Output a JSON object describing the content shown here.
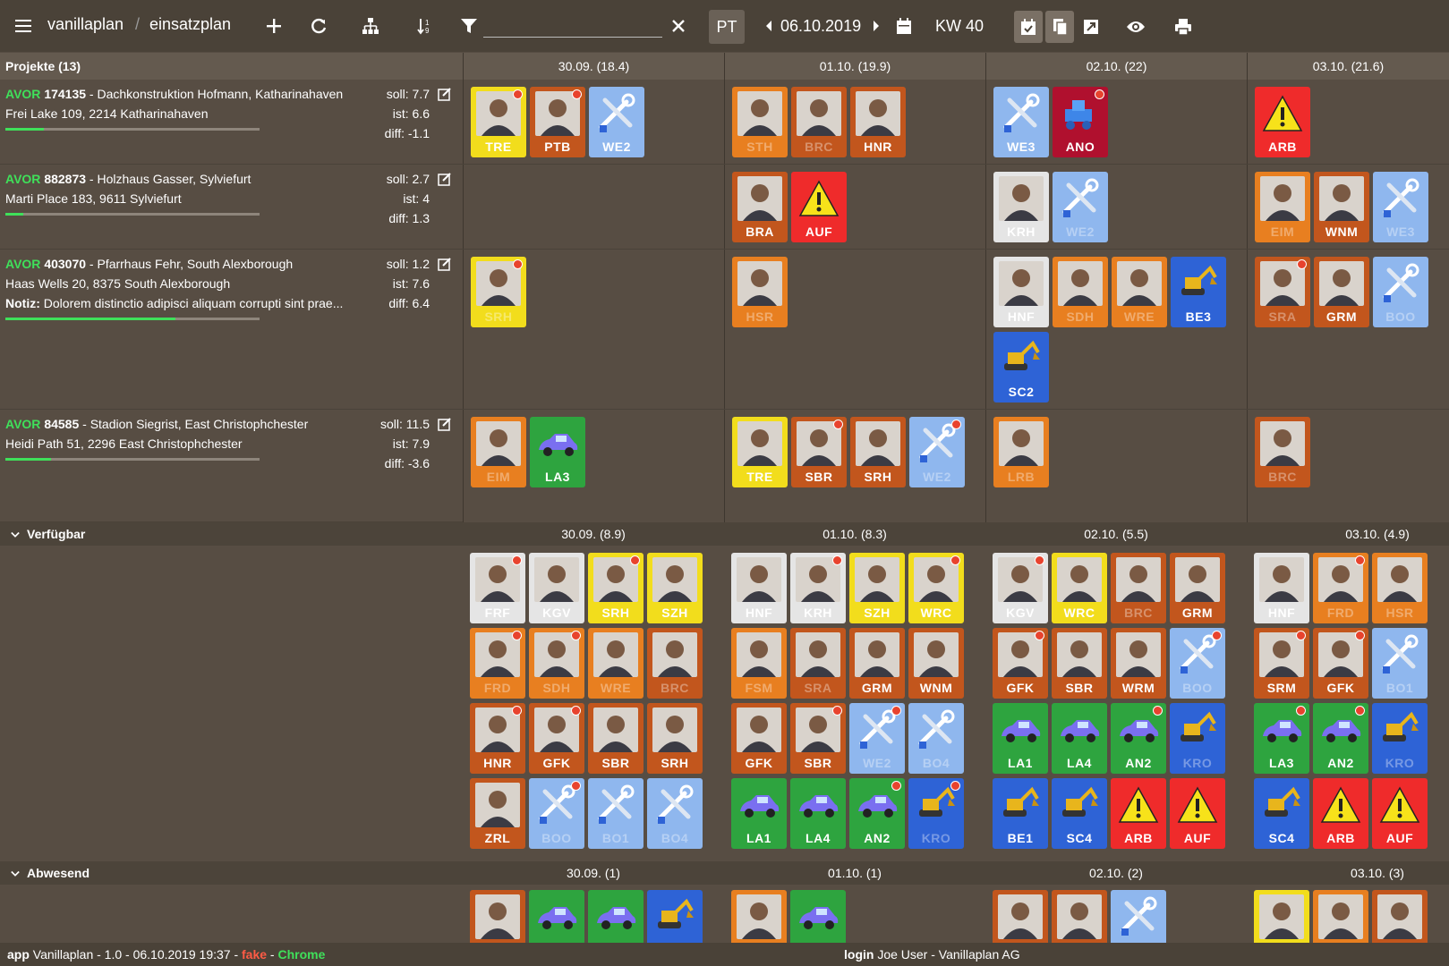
{
  "colors": {
    "yellow": "#f2dd1c",
    "orange": "#e87f20",
    "darkorange": "#c2561d",
    "red": "#ef2b2b",
    "lightblue": "#8fb7ee",
    "blue": "#2e63d6",
    "green": "#2ea43f",
    "white": "#e5e5e5",
    "crimson": "#b0102e"
  },
  "toolbar": {
    "menu_icon": "hamburger-icon",
    "breadcrumb": [
      "vanillaplan",
      "einsatzplan"
    ],
    "separator": "/",
    "filter_value": "",
    "pt_label": "PT",
    "date": "06.10.2019",
    "kw": "KW 40"
  },
  "projects_header": "Projekte (13)",
  "projects": [
    {
      "avor": "AVOR",
      "num": "174135",
      "title": " - Dachkonstruktion Hofmann, Katharinahaven",
      "addr": "Frei Lake 109, 2214 Katharinahaven",
      "note_label": "",
      "note": "",
      "soll": "soll: 7.7",
      "ist": "ist: 6.6",
      "diff": "diff: -1.1",
      "progress": 0.15
    },
    {
      "avor": "AVOR",
      "num": "882873",
      "title": " - Holzhaus Gasser, Sylviefurt",
      "addr": "Marti Place 183, 9611 Sylviefurt",
      "note_label": "",
      "note": "",
      "soll": "soll: 2.7",
      "ist": "ist: 4",
      "diff": "diff: 1.3",
      "progress": 0.07
    },
    {
      "avor": "AVOR",
      "num": "403070",
      "title": " - Pfarrhaus Fehr, South Alexborough",
      "addr": "Haas Wells 20, 8375 South Alexborough",
      "note_label": "Notiz:",
      "note": " Dolorem distinctio adipisci aliquam corrupti sint prae...",
      "soll": "soll: 1.2",
      "ist": "ist: 7.6",
      "diff": "diff: 6.4",
      "progress": 0.67
    },
    {
      "avor": "AVOR",
      "num": "84585",
      "title": " - Stadion Siegrist, East Christophchester",
      "addr": "Heidi Path 51, 2296 East Christophchester",
      "note_label": "",
      "note": "",
      "soll": "soll: 11.5",
      "ist": "ist: 7.9",
      "diff": "diff: -3.6",
      "progress": 0.18
    }
  ],
  "day_headers": [
    "30.09. (18.4)",
    "01.10. (19.9)",
    "02.10. (22)",
    "03.10. (21.6)"
  ],
  "project_tiles": [
    [
      [
        [
          "TRE",
          "yellow",
          "person",
          1,
          0
        ],
        [
          "PTB",
          "darkorange",
          "person",
          1,
          0
        ],
        [
          "WE2",
          "lightblue",
          "tools",
          0,
          0
        ]
      ],
      [
        [
          "STH",
          "orange",
          "person",
          0,
          1
        ],
        [
          "BRC",
          "darkorange",
          "person",
          0,
          1
        ],
        [
          "HNR",
          "darkorange",
          "person",
          0,
          0
        ]
      ],
      [
        [
          "WE3",
          "lightblue",
          "tools",
          0,
          0
        ],
        [
          "ANO",
          "crimson",
          "machine",
          1,
          0
        ]
      ],
      [
        [
          "ARB",
          "red",
          "warning",
          0,
          0
        ]
      ]
    ],
    [
      [],
      [
        [
          "BRA",
          "darkorange",
          "person",
          0,
          0
        ],
        [
          "AUF",
          "red",
          "warning",
          0,
          0
        ]
      ],
      [
        [
          "KRH",
          "white",
          "person",
          0,
          0
        ],
        [
          "WE2",
          "lightblue",
          "tools",
          0,
          1
        ]
      ],
      [
        [
          "EIM",
          "orange",
          "person",
          0,
          1
        ],
        [
          "WNM",
          "darkorange",
          "person",
          0,
          0
        ],
        [
          "WE3",
          "lightblue",
          "tools",
          0,
          1
        ]
      ]
    ],
    [
      [
        [
          "SRH",
          "yellow",
          "person",
          1,
          1
        ]
      ],
      [
        [
          "HSR",
          "orange",
          "person",
          0,
          1
        ]
      ],
      [
        [
          "HNF",
          "white",
          "person",
          0,
          0
        ],
        [
          "SDH",
          "orange",
          "person",
          0,
          1
        ],
        [
          "WRE",
          "orange",
          "person",
          0,
          1
        ],
        [
          "BE3",
          "blue",
          "excavator",
          0,
          0
        ],
        [
          "SC2",
          "blue",
          "excavator",
          0,
          0
        ]
      ],
      [
        [
          "SRA",
          "darkorange",
          "person",
          1,
          1
        ],
        [
          "GRM",
          "darkorange",
          "person",
          0,
          0
        ],
        [
          "BOO",
          "lightblue",
          "tools",
          0,
          1
        ]
      ]
    ],
    [
      [
        [
          "EIM",
          "orange",
          "person",
          0,
          1
        ],
        [
          "LA3",
          "green",
          "car",
          0,
          0
        ]
      ],
      [
        [
          "TRE",
          "yellow",
          "person",
          0,
          0
        ],
        [
          "SBR",
          "darkorange",
          "person",
          1,
          0
        ],
        [
          "SRH",
          "darkorange",
          "person",
          0,
          0
        ],
        [
          "WE2",
          "lightblue",
          "tools",
          1,
          1
        ]
      ],
      [
        [
          "LRB",
          "orange",
          "person",
          0,
          1
        ]
      ],
      [
        [
          "BRC",
          "darkorange",
          "person",
          0,
          1
        ]
      ]
    ]
  ],
  "verfuegbar": {
    "title": "Verfügbar",
    "dates": [
      "30.09. (8.9)",
      "01.10. (8.3)",
      "02.10. (5.5)",
      "03.10. (4.9)"
    ],
    "tiles": [
      [
        [
          "FRF",
          "white",
          "person",
          1,
          0
        ],
        [
          "KGV",
          "white",
          "person",
          0,
          0
        ],
        [
          "SRH",
          "yellow",
          "person",
          1,
          0
        ],
        [
          "SZH",
          "yellow",
          "person",
          0,
          0
        ],
        [
          "FRD",
          "orange",
          "person",
          1,
          1
        ],
        [
          "SDH",
          "orange",
          "person",
          1,
          1
        ],
        [
          "WRE",
          "orange",
          "person",
          0,
          1
        ],
        [
          "BRC",
          "darkorange",
          "person",
          0,
          1
        ],
        [
          "HNR",
          "darkorange",
          "person",
          1,
          0
        ],
        [
          "GFK",
          "darkorange",
          "person",
          1,
          0
        ],
        [
          "SBR",
          "darkorange",
          "person",
          0,
          0
        ],
        [
          "SRH",
          "darkorange",
          "person",
          0,
          0
        ],
        [
          "ZRL",
          "darkorange",
          "person",
          0,
          0
        ],
        [
          "BOO",
          "lightblue",
          "tools",
          1,
          1
        ],
        [
          "BO1",
          "lightblue",
          "tools",
          0,
          1
        ],
        [
          "BO4",
          "lightblue",
          "tools",
          0,
          1
        ]
      ],
      [
        [
          "HNF",
          "white",
          "person",
          0,
          0
        ],
        [
          "KRH",
          "white",
          "person",
          1,
          0
        ],
        [
          "SZH",
          "yellow",
          "person",
          0,
          0
        ],
        [
          "WRC",
          "yellow",
          "person",
          1,
          0
        ],
        [
          "FSM",
          "orange",
          "person",
          0,
          1
        ],
        [
          "SRA",
          "darkorange",
          "person",
          0,
          1
        ],
        [
          "GRM",
          "darkorange",
          "person",
          0,
          0
        ],
        [
          "WNM",
          "darkorange",
          "person",
          0,
          0
        ],
        [
          "GFK",
          "darkorange",
          "person",
          0,
          0
        ],
        [
          "SBR",
          "darkorange",
          "person",
          1,
          0
        ],
        [
          "WE2",
          "lightblue",
          "tools",
          1,
          1
        ],
        [
          "BO4",
          "lightblue",
          "tools",
          0,
          1
        ],
        [
          "LA1",
          "green",
          "car",
          0,
          0
        ],
        [
          "LA4",
          "green",
          "car",
          0,
          0
        ],
        [
          "AN2",
          "green",
          "car",
          1,
          0
        ],
        [
          "KRO",
          "blue",
          "excavator",
          1,
          1
        ]
      ],
      [
        [
          "KGV",
          "white",
          "person",
          1,
          0
        ],
        [
          "WRC",
          "yellow",
          "person",
          0,
          0
        ],
        [
          "BRC",
          "darkorange",
          "person",
          0,
          1
        ],
        [
          "GRM",
          "darkorange",
          "person",
          0,
          0
        ],
        [
          "GFK",
          "darkorange",
          "person",
          1,
          0
        ],
        [
          "SBR",
          "darkorange",
          "person",
          0,
          0
        ],
        [
          "WRM",
          "darkorange",
          "person",
          0,
          0
        ],
        [
          "BOO",
          "lightblue",
          "tools",
          1,
          1
        ],
        [
          "LA1",
          "green",
          "car",
          0,
          0
        ],
        [
          "LA4",
          "green",
          "car",
          0,
          0
        ],
        [
          "AN2",
          "green",
          "car",
          1,
          0
        ],
        [
          "KRO",
          "blue",
          "excavator",
          0,
          1
        ],
        [
          "BE1",
          "blue",
          "excavator",
          0,
          0
        ],
        [
          "SC4",
          "blue",
          "excavator",
          0,
          0
        ],
        [
          "ARB",
          "red",
          "warning",
          0,
          0
        ],
        [
          "AUF",
          "red",
          "warning",
          0,
          0
        ]
      ],
      [
        [
          "HNF",
          "white",
          "person",
          0,
          0
        ],
        [
          "FRD",
          "orange",
          "person",
          1,
          1
        ],
        [
          "HSR",
          "orange",
          "person",
          0,
          1
        ],
        [
          "SRM",
          "darkorange",
          "person",
          1,
          0
        ],
        [
          "GFK",
          "darkorange",
          "person",
          1,
          0
        ],
        [
          "BO1",
          "lightblue",
          "tools",
          0,
          1
        ],
        [
          "LA3",
          "green",
          "car",
          1,
          0
        ],
        [
          "AN2",
          "green",
          "car",
          1,
          0
        ],
        [
          "KRO",
          "blue",
          "excavator",
          0,
          1
        ],
        [
          "SC4",
          "blue",
          "excavator",
          0,
          0
        ],
        [
          "ARB",
          "red",
          "warning",
          0,
          0
        ],
        [
          "AUF",
          "red",
          "warning",
          0,
          0
        ]
      ]
    ]
  },
  "abwesend": {
    "title": "Abwesend",
    "dates": [
      "30.09. (1)",
      "01.10. (1)",
      "02.10. (2)",
      "03.10. (3)"
    ],
    "tiles": [
      [
        [
          "",
          "darkorange",
          "person",
          0,
          0
        ],
        [
          "",
          "green",
          "car",
          0,
          0
        ],
        [
          "",
          "green",
          "car",
          0,
          0
        ],
        [
          "",
          "blue",
          "excavator",
          0,
          0
        ]
      ],
      [
        [
          "",
          "orange",
          "person",
          0,
          0
        ],
        [
          "",
          "green",
          "car",
          0,
          0
        ]
      ],
      [
        [
          "",
          "darkorange",
          "person",
          0,
          0
        ],
        [
          "",
          "darkorange",
          "person",
          0,
          0
        ],
        [
          "",
          "lightblue",
          "tools",
          0,
          0
        ]
      ],
      [
        [
          "",
          "yellow",
          "person",
          0,
          0
        ],
        [
          "",
          "orange",
          "person",
          0,
          0
        ],
        [
          "",
          "darkorange",
          "person",
          0,
          0
        ]
      ]
    ]
  },
  "status": {
    "app_label": "app",
    "app_text": " Vanillaplan - 1.0 - 06.10.2019 19:37 - ",
    "fake": "fake",
    "dash": " - ",
    "browser": "Chrome",
    "login_label": "login",
    "login_text": " Joe User - Vanillaplan AG"
  }
}
